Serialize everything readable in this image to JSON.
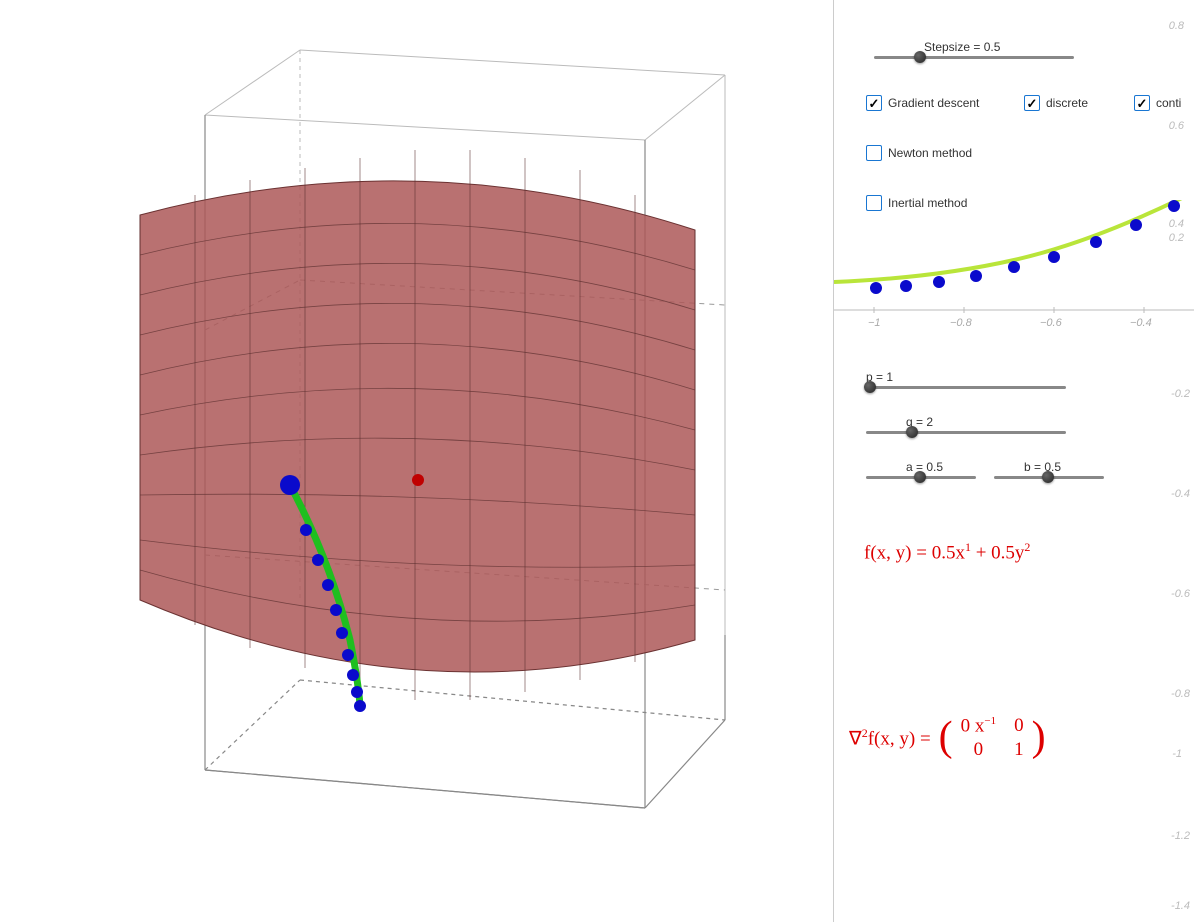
{
  "sliders": {
    "stepsize": {
      "label": "Stepsize = 0.5",
      "value": 0.5
    },
    "p": {
      "label": "p = 1",
      "value": 1
    },
    "q": {
      "label": "q = 2",
      "value": 2
    },
    "a": {
      "label": "a = 0.5",
      "value": 0.5
    },
    "b": {
      "label": "b = 0.5",
      "value": 0.5
    }
  },
  "checkboxes": {
    "gradient_descent": {
      "label": "Gradient descent",
      "checked": true
    },
    "discrete": {
      "label": "discrete",
      "checked": true
    },
    "continuous": {
      "label": "conti",
      "checked": true
    },
    "newton": {
      "label": "Newton method",
      "checked": false
    },
    "inertial": {
      "label": "Inertial method",
      "checked": false
    }
  },
  "formulas": {
    "f": "f(x, y) = 0.5x¹ + 0.5y²",
    "hessian_lhs": "∇²f(x, y) =",
    "hessian_m00": "0 x⁻¹",
    "hessian_m01": "0",
    "hessian_m10": "0",
    "hessian_m11": "1"
  },
  "right_axis_y": [
    "0.8",
    "0.6",
    "0.4",
    "0.2",
    "-0.2",
    "-0.4",
    "-0.6",
    "-0.8",
    "-1",
    "-1.2",
    "-1.4"
  ],
  "right_axis_x": [
    "-1",
    "-0.8",
    "-0.6",
    "-0.4"
  ],
  "chart_data": {
    "type": "line",
    "right_curve_points": [
      {
        "x": -1.15,
        "y": 0.075
      },
      {
        "x": -1.0,
        "y": 0.085
      },
      {
        "x": -0.9,
        "y": 0.1
      },
      {
        "x": -0.8,
        "y": 0.12
      },
      {
        "x": -0.7,
        "y": 0.15
      },
      {
        "x": -0.6,
        "y": 0.19
      },
      {
        "x": -0.5,
        "y": 0.23
      },
      {
        "x": -0.4,
        "y": 0.29
      },
      {
        "x": -0.3,
        "y": 0.37
      }
    ],
    "right_discrete_points": [
      {
        "x": -1.0,
        "y": 0.07
      },
      {
        "x": -0.93,
        "y": 0.075
      },
      {
        "x": -0.85,
        "y": 0.085
      },
      {
        "x": -0.77,
        "y": 0.1
      },
      {
        "x": -0.68,
        "y": 0.12
      },
      {
        "x": -0.6,
        "y": 0.145
      },
      {
        "x": -0.5,
        "y": 0.18
      },
      {
        "x": -0.42,
        "y": 0.22
      },
      {
        "x": -0.33,
        "y": 0.27
      }
    ],
    "surface_3d_path_points": 10
  }
}
